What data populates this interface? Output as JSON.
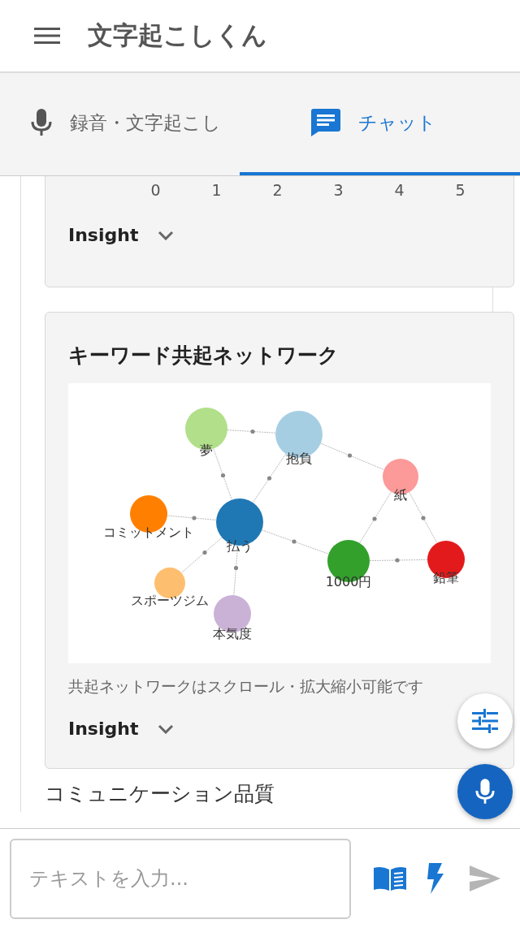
{
  "app_bar": {
    "title": "文字起こしくん"
  },
  "tabs": [
    {
      "label": "録音・文字起こし",
      "selected": false
    },
    {
      "label": "チャット",
      "selected": true
    }
  ],
  "previous_card": {
    "axis_ticks": [
      "0",
      "1",
      "2",
      "3",
      "4",
      "5"
    ],
    "insight": {
      "label": "Insight",
      "expanded": false
    }
  },
  "network_card": {
    "title": "キーワード共起ネットワーク",
    "nodes": [
      {
        "label": "夢",
        "color": "#b2df8a"
      },
      {
        "label": "抱負",
        "color": "#a6cee3"
      },
      {
        "label": "紙",
        "color": "#fb9a99"
      },
      {
        "label": "コミットメント",
        "color": "#ff7f00"
      },
      {
        "label": "払う",
        "color": "#1f78b4"
      },
      {
        "label": "1000円",
        "color": "#33a02c"
      },
      {
        "label": "鉛筆",
        "color": "#e31a1c"
      },
      {
        "label": "スポーツジム",
        "color": "#fdbf6f"
      },
      {
        "label": "本気度",
        "color": "#cab2d6"
      }
    ],
    "caption": "共起ネットワークはスクロール・拡大縮小可能です",
    "insight": {
      "label": "Insight",
      "expanded": false
    }
  },
  "next_section": {
    "title": "コミュニケーション品質"
  },
  "composer": {
    "placeholder": "テキストを入力...",
    "send_disabled": true
  }
}
